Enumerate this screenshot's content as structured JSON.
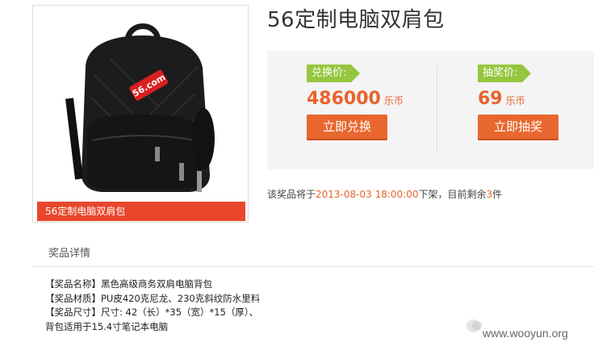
{
  "product": {
    "title": "56定制电脑双肩包",
    "image_caption": "56定制电脑双肩包",
    "bag_logo_text": "56.com"
  },
  "exchange": {
    "tag_label": "兑换价:",
    "price": "486000",
    "unit": "乐币",
    "button_label": "立即兑换"
  },
  "lottery": {
    "tag_label": "抽奖价:",
    "price": "69",
    "unit": "乐币",
    "button_label": "立即抽奖"
  },
  "status": {
    "prefix": "该奖品将于",
    "datetime": "2013-08-03 18:00:00",
    "middle": "下架，目前剩余",
    "remaining": "3",
    "suffix": "件"
  },
  "details_tab": {
    "label": "奖品详情"
  },
  "details": {
    "lines": [
      "【奖品名称】黑色高级商务双肩电脑背包",
      "【奖品材质】PU皮420克尼龙、230克斜纹防水里料",
      "【奖品尺寸】尺寸: 42（长）*35（宽）*15（厚）、",
      "背包适用于15.4寸笔记本电脑"
    ]
  },
  "watermark": {
    "text": "www.wooyun.org"
  },
  "colors": {
    "accent_orange": "#e8632c",
    "caption_red": "#e8472c",
    "tag_green": "#95c63e",
    "panel_bg": "#f4f4f4"
  }
}
